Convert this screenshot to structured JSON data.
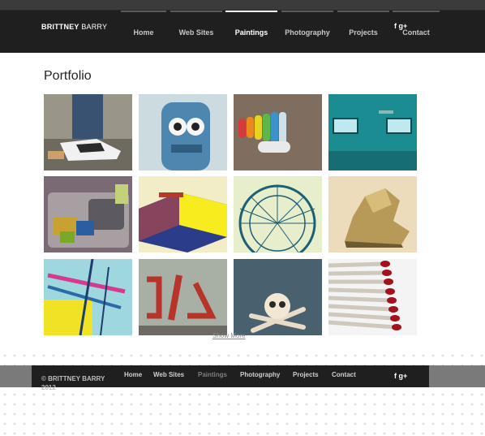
{
  "header": {
    "brand_bold": "BRITTNEY",
    "brand_rest": "BARRY",
    "nav": [
      "Home",
      "Web Sites",
      "Paintings",
      "Photography",
      "Projects",
      "Contact"
    ],
    "active_nav": "Paintings",
    "social": "f  g+"
  },
  "main": {
    "title": "Portfolio",
    "thumbnails": [
      {
        "label": "sneakers on skateboard",
        "icon": "photo"
      },
      {
        "label": "blue toy robot",
        "icon": "photo"
      },
      {
        "label": "colorful crayons",
        "icon": "photo"
      },
      {
        "label": "teal wall with windows",
        "icon": "photo"
      },
      {
        "label": "cluttered sink",
        "icon": "photo"
      },
      {
        "label": "yellow matchbox",
        "icon": "photo"
      },
      {
        "label": "ferris wheel",
        "icon": "photo"
      },
      {
        "label": "gold boot",
        "icon": "photo"
      },
      {
        "label": "carnival ride",
        "icon": "photo"
      },
      {
        "label": "painted airplane",
        "icon": "photo"
      },
      {
        "label": "skull and crossbones",
        "icon": "photo"
      },
      {
        "label": "red matches",
        "icon": "photo"
      }
    ],
    "show_more": "Show More"
  },
  "footer": {
    "copyright_line1": "© BRITTNEY BARRY",
    "copyright_line2": "2012",
    "nav": [
      "Home",
      "Web Sites",
      "Paintings",
      "Photography",
      "Projects",
      "Contact"
    ],
    "active_nav": "Paintings",
    "social": "f  g+"
  },
  "colors": {
    "header_bg": "#1f1f1f",
    "nav_text": "#c7c7c7",
    "nav_active": "#ffffff",
    "footer_active": "#7e7e7e"
  }
}
